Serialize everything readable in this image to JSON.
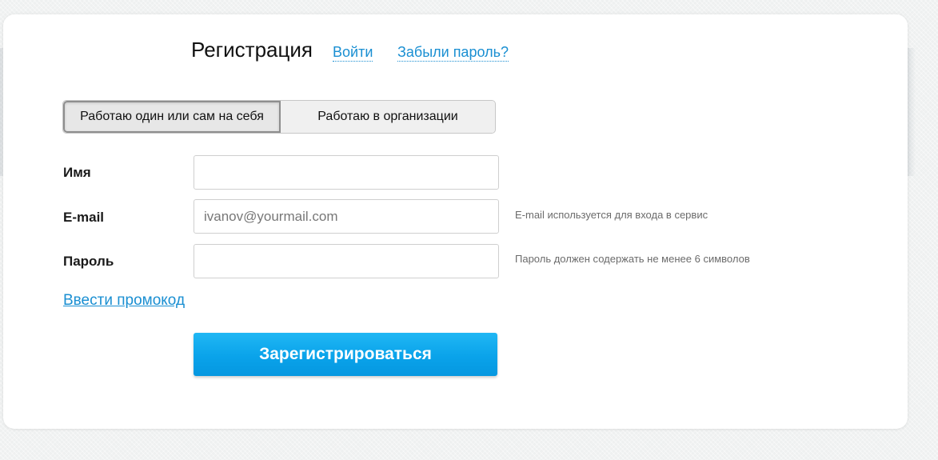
{
  "header": {
    "title": "Регистрация",
    "login_link": "Войти",
    "forgot_link": "Забыли пароль?"
  },
  "account_type": {
    "options": [
      {
        "label": "Работаю один или сам на себя",
        "selected": true
      },
      {
        "label": "Работаю в организации",
        "selected": false
      }
    ]
  },
  "form": {
    "name": {
      "label": "Имя",
      "value": "",
      "placeholder": ""
    },
    "email": {
      "label": "E-mail",
      "value": "",
      "placeholder": "ivanov@yourmail.com",
      "hint": "E-mail используется для входа в сервис"
    },
    "password": {
      "label": "Пароль",
      "value": "",
      "placeholder": "",
      "hint": "Пароль должен содержать не менее 6 символов"
    },
    "promo_link": "Ввести промокод",
    "submit_label": "Зарегистрироваться"
  },
  "colors": {
    "link": "#1a8fd2",
    "button": "#0aa3ea",
    "background": "#eef0f0"
  }
}
